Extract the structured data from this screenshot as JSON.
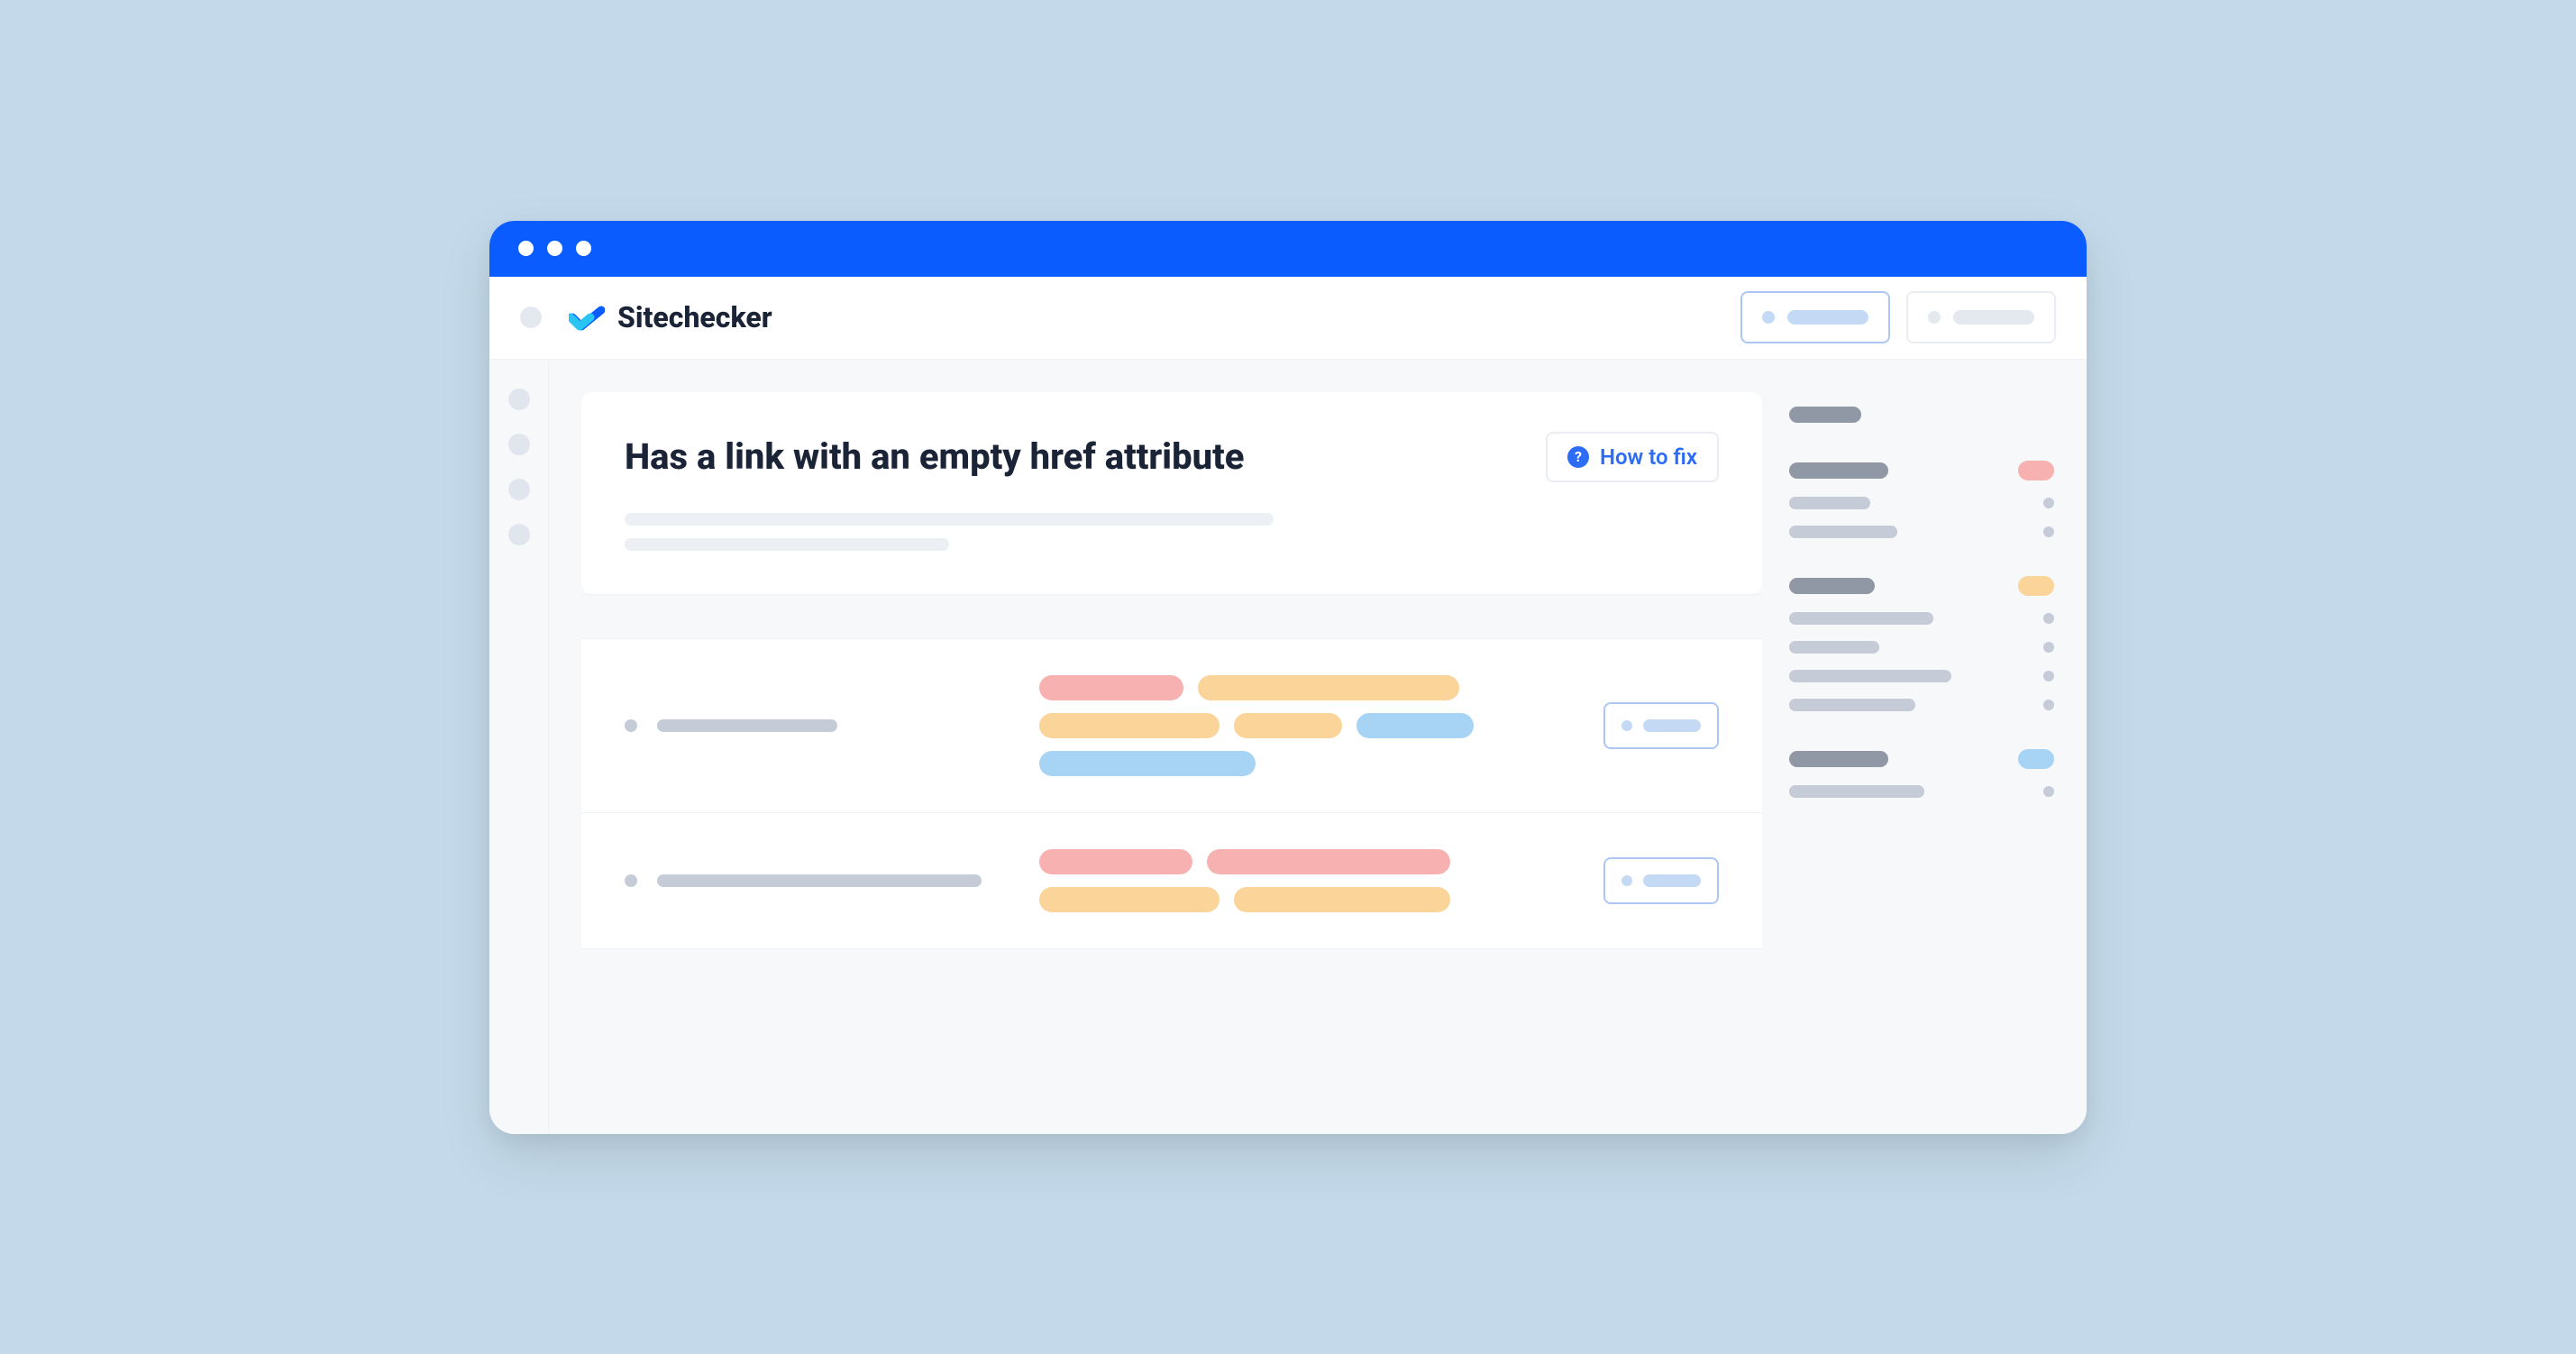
{
  "brand": {
    "name": "Sitechecker"
  },
  "issue": {
    "title": "Has a link with an empty href attribute",
    "how_to_fix_label": "How to fix"
  }
}
